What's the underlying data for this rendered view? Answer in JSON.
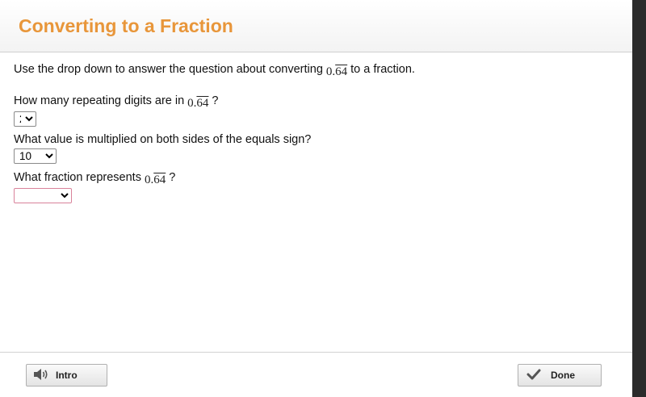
{
  "header": {
    "title": "Converting to a Fraction"
  },
  "main": {
    "instruction_before": "Use the drop down to answer the question about converting",
    "instruction_after": "to a fraction.",
    "math_whole": "0.",
    "math_repeat": "64",
    "questions": [
      {
        "before": "How many repeating digits are in",
        "after": "?",
        "selected": "2"
      },
      {
        "text": "What value is multiplied on both sides of the equals sign?",
        "selected": "10"
      },
      {
        "before": "What fraction represents",
        "after": "?",
        "selected": ""
      }
    ]
  },
  "footer": {
    "intro_label": "Intro",
    "done_label": "Done"
  },
  "colors": {
    "title": "#e8963a",
    "invalid_border": "#d9829a"
  }
}
